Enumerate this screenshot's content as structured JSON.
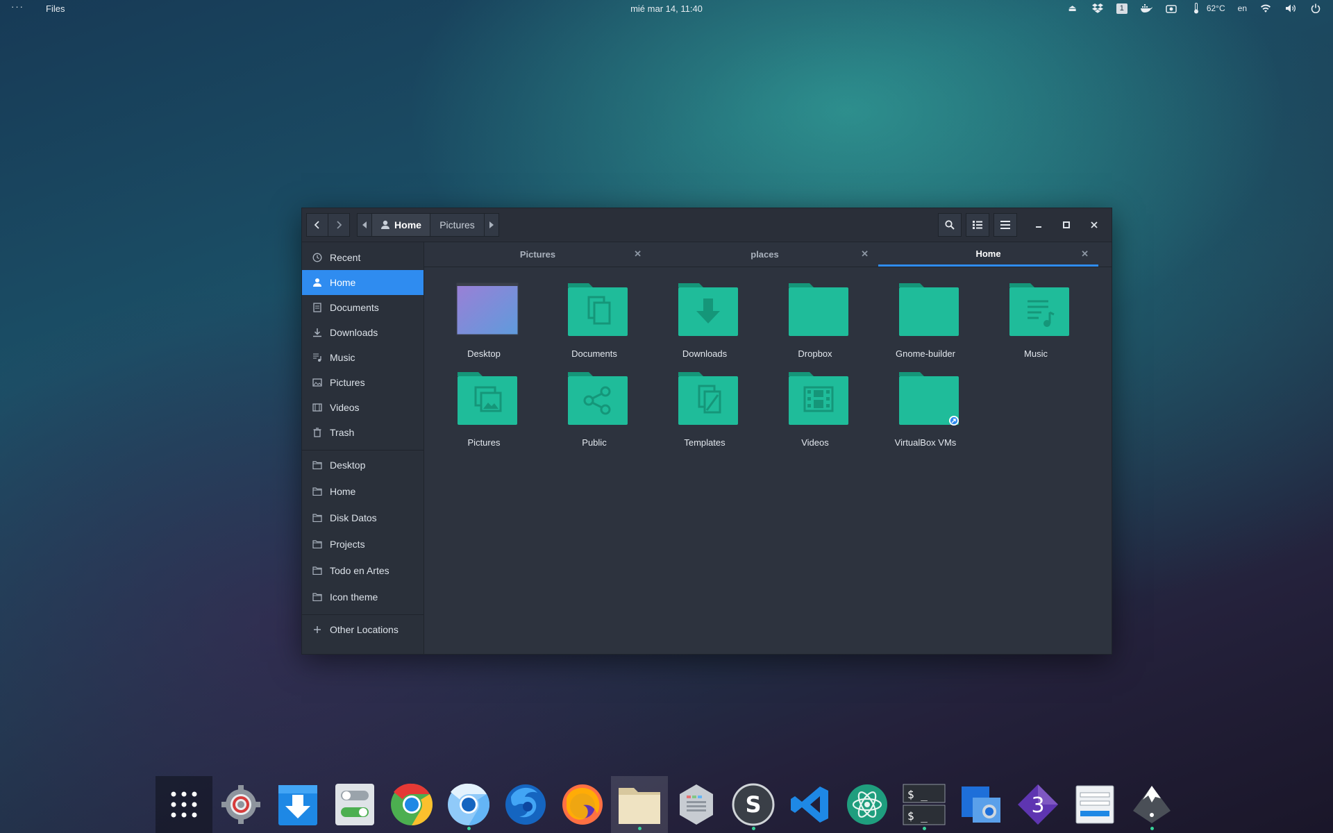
{
  "topbar": {
    "activities": "···",
    "app_name": "Files",
    "clock": "mié mar 14, 11:40",
    "workspace": "1",
    "temperature": "62°C",
    "keyboard_layout": "en"
  },
  "window": {
    "nav": {
      "back_icon": "chevron-left-icon",
      "forward_icon": "chevron-right-icon"
    },
    "path": [
      {
        "label": "Home",
        "icon": "user-icon"
      },
      {
        "label": "Pictures"
      }
    ],
    "tabs": [
      {
        "label": "Pictures",
        "active": false
      },
      {
        "label": "places",
        "active": false
      },
      {
        "label": "Home",
        "active": true
      }
    ],
    "sidebar": {
      "places": [
        {
          "label": "Recent",
          "icon": "clock-icon"
        },
        {
          "label": "Home",
          "icon": "home-icon",
          "active": true
        },
        {
          "label": "Documents",
          "icon": "document-icon"
        },
        {
          "label": "Downloads",
          "icon": "download-icon"
        },
        {
          "label": "Music",
          "icon": "music-icon"
        },
        {
          "label": "Pictures",
          "icon": "image-icon"
        },
        {
          "label": "Videos",
          "icon": "video-icon"
        },
        {
          "label": "Trash",
          "icon": "trash-icon"
        }
      ],
      "bookmarks": [
        {
          "label": "Desktop",
          "icon": "folder-icon"
        },
        {
          "label": "Home",
          "icon": "folder-icon"
        },
        {
          "label": "Disk Datos",
          "icon": "folder-icon"
        },
        {
          "label": "Projects",
          "icon": "folder-icon"
        },
        {
          "label": "Todo en Artes",
          "icon": "folder-icon"
        },
        {
          "label": "Icon theme",
          "icon": "folder-icon"
        }
      ],
      "other_locations": "Other Locations"
    },
    "files": [
      {
        "label": "Desktop",
        "icon": "desktop-folder-icon"
      },
      {
        "label": "Documents",
        "icon": "documents-folder-icon"
      },
      {
        "label": "Downloads",
        "icon": "downloads-folder-icon"
      },
      {
        "label": "Dropbox",
        "icon": "folder-icon"
      },
      {
        "label": "Gnome-builder",
        "icon": "folder-icon"
      },
      {
        "label": "Music",
        "icon": "music-folder-icon"
      },
      {
        "label": "Pictures",
        "icon": "pictures-folder-icon"
      },
      {
        "label": "Public",
        "icon": "public-folder-icon"
      },
      {
        "label": "Templates",
        "icon": "templates-folder-icon"
      },
      {
        "label": "Videos",
        "icon": "videos-folder-icon"
      },
      {
        "label": "VirtualBox VMs",
        "icon": "symlink-folder-icon"
      }
    ]
  },
  "dock": [
    {
      "name": "app-grid",
      "running": false
    },
    {
      "name": "settings",
      "running": false
    },
    {
      "name": "downloader",
      "running": false
    },
    {
      "name": "tweaks",
      "running": false
    },
    {
      "name": "chrome",
      "running": false
    },
    {
      "name": "chromium",
      "running": true
    },
    {
      "name": "firefox-developer",
      "running": false
    },
    {
      "name": "firefox",
      "running": false
    },
    {
      "name": "files",
      "running": true
    },
    {
      "name": "color-picker",
      "running": false
    },
    {
      "name": "sublime-merge",
      "running": true
    },
    {
      "name": "vscode",
      "running": false
    },
    {
      "name": "atom",
      "running": false
    },
    {
      "name": "terminal",
      "running": true
    },
    {
      "name": "screenshot",
      "running": false
    },
    {
      "name": "gnome-3",
      "running": false
    },
    {
      "name": "glade",
      "running": false
    },
    {
      "name": "inkscape",
      "running": true
    }
  ],
  "colors": {
    "accent": "#2f8cf0",
    "folder": "#1fbc9a",
    "folder_dark": "#159679",
    "window_bg": "#2d333e"
  }
}
